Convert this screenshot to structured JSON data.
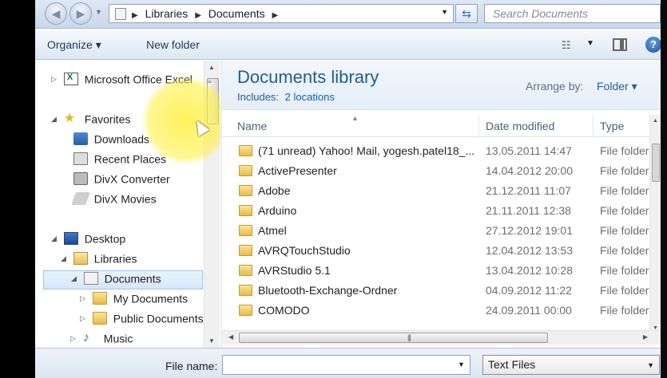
{
  "address": {
    "breadcrumbs": [
      "Libraries",
      "Documents"
    ],
    "search_placeholder": "Search Documents"
  },
  "toolbar": {
    "organize_label": "Organize ▾",
    "new_folder_label": "New folder",
    "help_label": "?"
  },
  "nav": {
    "items": [
      {
        "label": "Microsoft Office Excel",
        "icon": "excel-icon"
      },
      {
        "label": "Favorites",
        "icon": "star-icon"
      },
      {
        "label": "Downloads",
        "icon": "downloads-icon"
      },
      {
        "label": "Recent Places",
        "icon": "recent-places-icon"
      },
      {
        "label": "DivX Converter",
        "icon": "divx-icon"
      },
      {
        "label": "DivX Movies",
        "icon": "movies-icon"
      },
      {
        "label": "Desktop",
        "icon": "desktop-icon"
      },
      {
        "label": "Libraries",
        "icon": "libraries-icon"
      },
      {
        "label": "Documents",
        "icon": "documents-icon"
      },
      {
        "label": "My Documents",
        "icon": "folder-icon"
      },
      {
        "label": "Public Documents",
        "icon": "folder-icon"
      },
      {
        "label": "Music",
        "icon": "music-icon"
      }
    ]
  },
  "library": {
    "title": "Documents library",
    "includes_label": "Includes:",
    "includes_link": "2 locations",
    "arrange_label": "Arrange by:",
    "arrange_value": "Folder ▾"
  },
  "columns": {
    "name": "Name",
    "date": "Date modified",
    "type": "Type"
  },
  "files": [
    {
      "name": "(71 unread) Yahoo! Mail, yogesh.patel18_...",
      "date": "13.05.2011 14:47",
      "type": "File folder"
    },
    {
      "name": "ActivePresenter",
      "date": "14.04.2012 20:00",
      "type": "File folder"
    },
    {
      "name": "Adobe",
      "date": "21.12.2011 11:07",
      "type": "File folder"
    },
    {
      "name": "Arduino",
      "date": "21.11.2011 12:38",
      "type": "File folder"
    },
    {
      "name": "Atmel",
      "date": "27.12.2012 19:01",
      "type": "File folder"
    },
    {
      "name": "AVRQTouchStudio",
      "date": "12.04.2012 13:53",
      "type": "File folder"
    },
    {
      "name": "AVRStudio 5.1",
      "date": "13.04.2012 10:28",
      "type": "File folder"
    },
    {
      "name": "Bluetooth-Exchange-Ordner",
      "date": "04.09.2012 11:22",
      "type": "File folder"
    },
    {
      "name": "COMODO",
      "date": "24.09.2011 00:00",
      "type": "File folder"
    }
  ],
  "bottom": {
    "file_name_label": "File name:",
    "file_name_value": "",
    "filter_value": "Text Files"
  }
}
